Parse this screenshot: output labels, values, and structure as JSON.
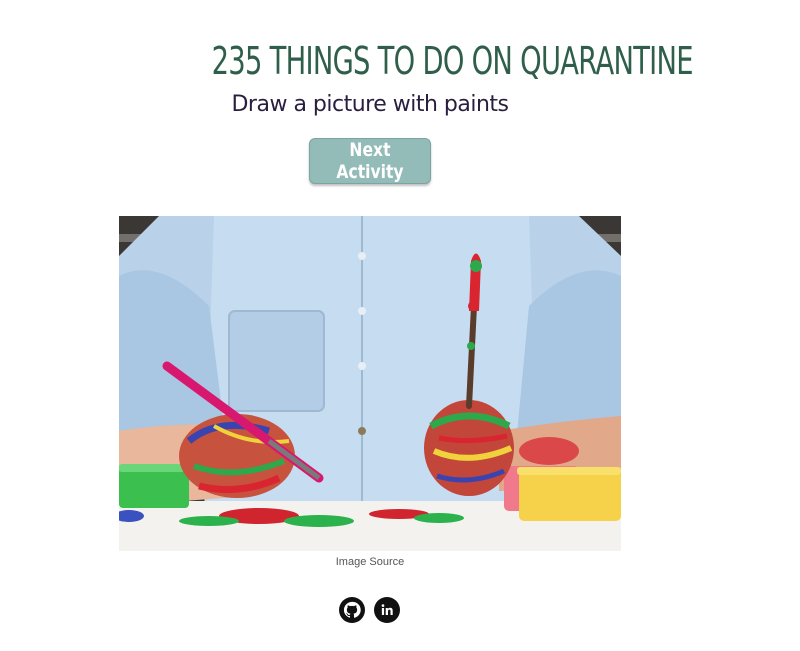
{
  "header": {
    "title": "235 THINGS TO DO ON QUARANTINE"
  },
  "activity": {
    "text": "Draw a picture with paints"
  },
  "controls": {
    "next_label": "Next Activity"
  },
  "image": {
    "alt": "Hands covered in colorful paint holding a pencil and a paintbrush",
    "source_label": "Image Source"
  },
  "social": {
    "links": [
      {
        "icon": "github-icon"
      },
      {
        "icon": "linkedin-icon"
      }
    ]
  },
  "colors": {
    "title": "#2f5f4a",
    "button": "#93bcb9",
    "activity_text": "#2a1e3e"
  }
}
